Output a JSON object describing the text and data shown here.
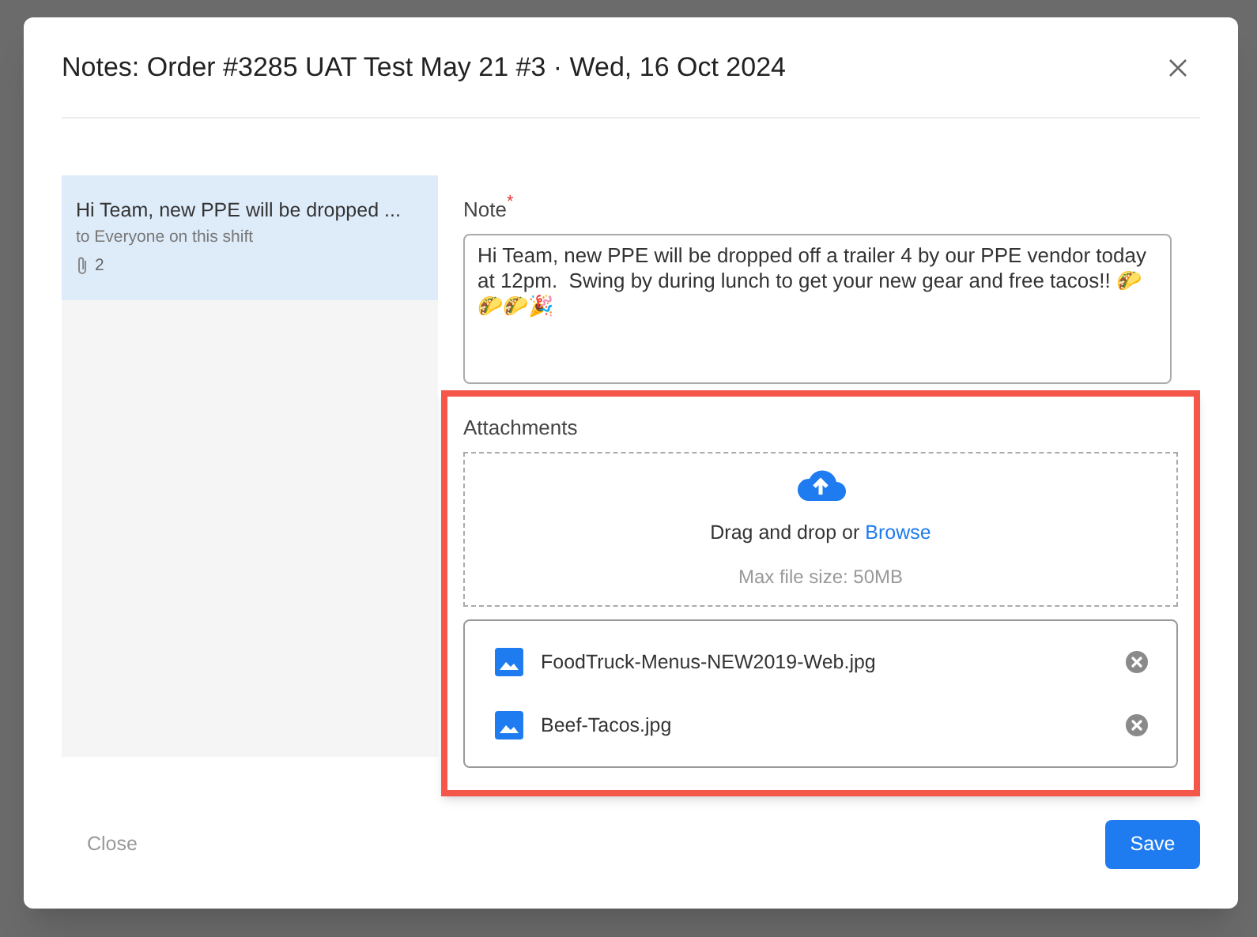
{
  "dialog": {
    "title": "Notes: Order #3285 UAT Test May 21 #3 · Wed, 16 Oct 2024"
  },
  "notes_list": [
    {
      "preview": "Hi Team, new PPE will be dropped ...",
      "recipients": "to Everyone on this shift",
      "attachment_count": "2",
      "selected": true
    }
  ],
  "note_field": {
    "label": "Note",
    "required_mark": "*",
    "value": "Hi Team, new PPE will be dropped off a trailer 4 by our PPE vendor today at 12pm.  Swing by during lunch to get your new gear and free tacos!! 🌮🌮🌮🎉"
  },
  "attachments": {
    "label": "Attachments",
    "highlighted": true,
    "dropzone": {
      "prompt": "Drag and drop or",
      "link": "Browse",
      "hint": "Max file size: 50MB"
    },
    "files": [
      {
        "name": "FoodTruck-Menus-NEW2019-Web.jpg"
      },
      {
        "name": "Beef-Tacos.jpg"
      }
    ]
  },
  "footer": {
    "close": "Close",
    "save": "Save"
  }
}
